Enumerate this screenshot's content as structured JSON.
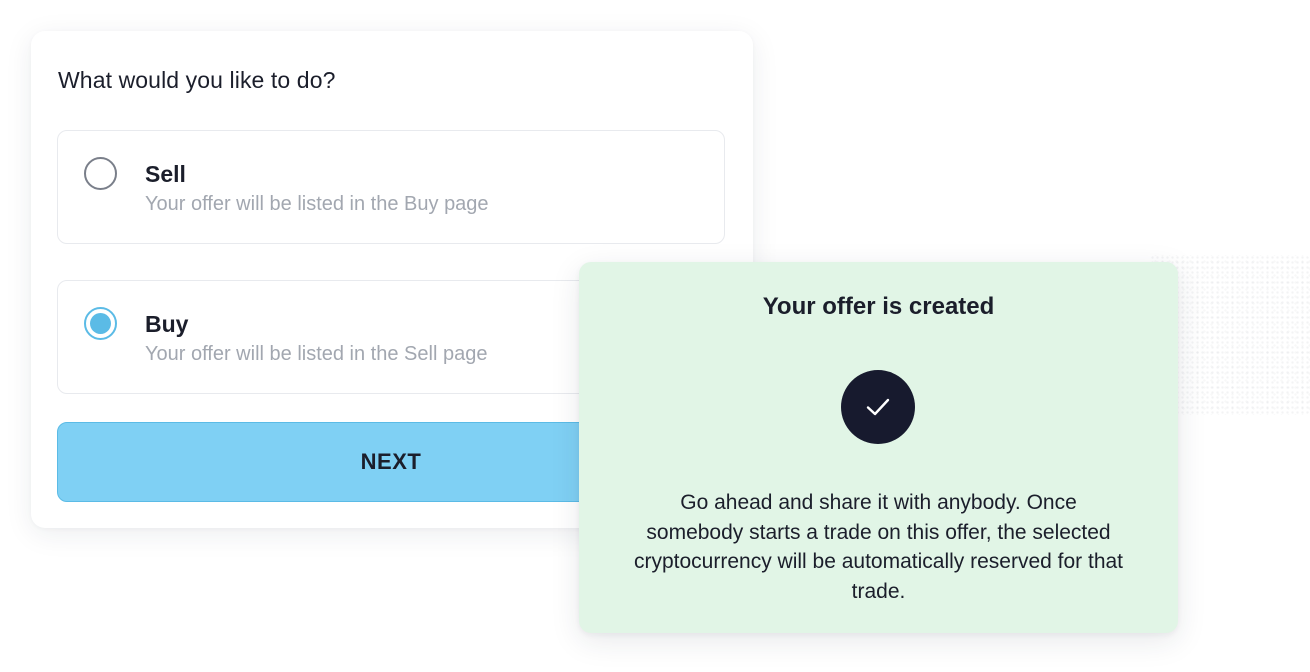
{
  "form": {
    "question": "What would you like to do?",
    "options": [
      {
        "title": "Sell",
        "description": "Your offer will be listed in the Buy page",
        "selected": false
      },
      {
        "title": "Buy",
        "description": "Your offer will be listed in the Sell page",
        "selected": true
      }
    ],
    "next_label": "NEXT"
  },
  "success": {
    "title": "Your offer is created",
    "icon": "check-icon",
    "body": "Go ahead and share it with anybody. Once somebody starts a trade on this offer, the selected cryptocurrency will be automatically reserved for that trade."
  },
  "colors": {
    "accent": "#5bbbe6",
    "button_fill": "#7fd0f4",
    "success_background": "#e1f5e6",
    "check_circle": "#171a2e"
  }
}
